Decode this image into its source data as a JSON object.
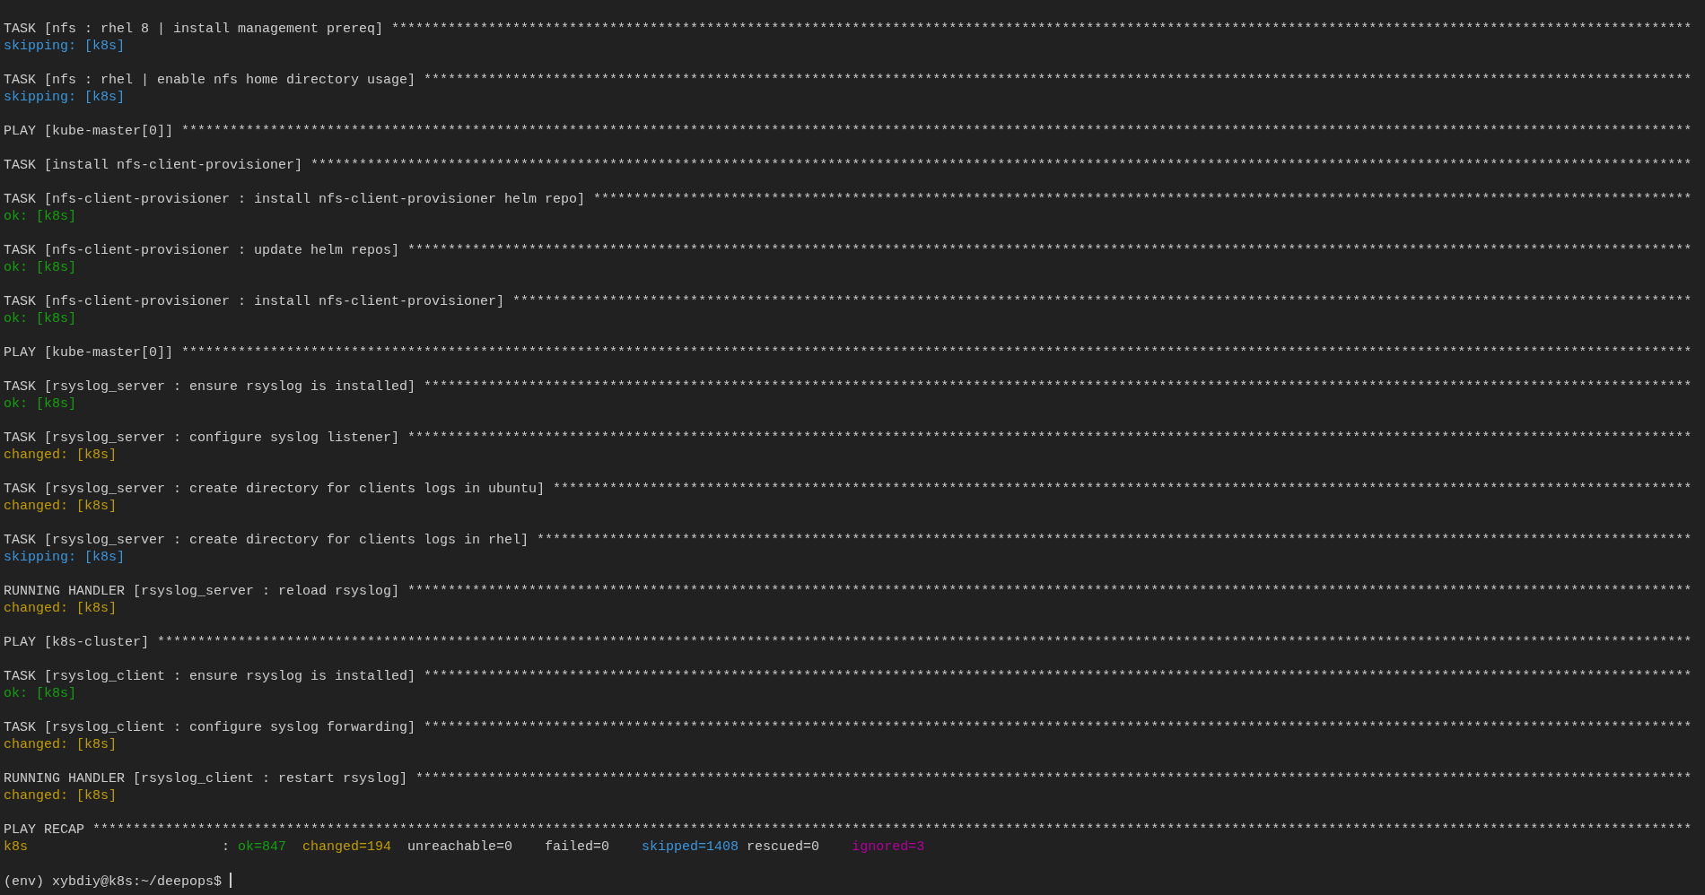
{
  "blocks": [
    {
      "header": "TASK [nfs : rhel 8 | install management prereq] *****************************************************************************************************************************************************************",
      "result": {
        "kind": "skipping",
        "text": "skipping: [k8s]"
      }
    },
    {
      "header": "TASK [nfs : rhel | enable nfs home directory usage] *************************************************************************************************************************************************************",
      "result": {
        "kind": "skipping",
        "text": "skipping: [k8s]"
      }
    },
    {
      "header": "PLAY [kube-master[0]] *******************************************************************************************************************************************************************************************"
    },
    {
      "header": "TASK [install nfs-client-provisioner] ***************************************************************************************************************************************************************************"
    },
    {
      "header": "TASK [nfs-client-provisioner : install nfs-client-provisioner helm repo] ****************************************************************************************************************************************",
      "result": {
        "kind": "ok",
        "text": "ok: [k8s]"
      }
    },
    {
      "header": "TASK [nfs-client-provisioner : update helm repos] ***************************************************************************************************************************************************************",
      "result": {
        "kind": "ok",
        "text": "ok: [k8s]"
      }
    },
    {
      "header": "TASK [nfs-client-provisioner : install nfs-client-provisioner] **************************************************************************************************************************************************",
      "result": {
        "kind": "ok",
        "text": "ok: [k8s]"
      }
    },
    {
      "header": "PLAY [kube-master[0]] *******************************************************************************************************************************************************************************************"
    },
    {
      "header": "TASK [rsyslog_server : ensure rsyslog is installed] *************************************************************************************************************************************************************",
      "result": {
        "kind": "ok",
        "text": "ok: [k8s]"
      }
    },
    {
      "header": "TASK [rsyslog_server : configure syslog listener] ***************************************************************************************************************************************************************",
      "result": {
        "kind": "changed",
        "text": "changed: [k8s]"
      }
    },
    {
      "header": "TASK [rsyslog_server : create directory for clients logs in ubuntu] *********************************************************************************************************************************************",
      "result": {
        "kind": "changed",
        "text": "changed: [k8s]"
      }
    },
    {
      "header": "TASK [rsyslog_server : create directory for clients logs in rhel] ***********************************************************************************************************************************************",
      "result": {
        "kind": "skipping",
        "text": "skipping: [k8s]"
      }
    },
    {
      "header": "RUNNING HANDLER [rsyslog_server : reload rsyslog] ***************************************************************************************************************************************************************",
      "result": {
        "kind": "changed",
        "text": "changed: [k8s]"
      }
    },
    {
      "header": "PLAY [k8s-cluster] **********************************************************************************************************************************************************************************************"
    },
    {
      "header": "TASK [rsyslog_client : ensure rsyslog is installed] *************************************************************************************************************************************************************",
      "result": {
        "kind": "ok",
        "text": "ok: [k8s]"
      }
    },
    {
      "header": "TASK [rsyslog_client : configure syslog forwarding] *************************************************************************************************************************************************************",
      "result": {
        "kind": "changed",
        "text": "changed: [k8s]"
      }
    },
    {
      "header": "RUNNING HANDLER [rsyslog_client : restart rsyslog] **************************************************************************************************************************************************************",
      "result": {
        "kind": "changed",
        "text": "changed: [k8s]"
      }
    }
  ],
  "recap": {
    "header": "PLAY RECAP ******************************************************************************************************************************************************************************************************",
    "host": {
      "text": "k8s",
      "color": "#c19c00"
    },
    "separator": ":",
    "stats": [
      {
        "text": "ok=847",
        "color": "#13a10e"
      },
      {
        "text": "changed=194",
        "color": "#c19c00"
      },
      {
        "text": "unreachable=0",
        "color": "#cccccc"
      },
      {
        "text": "failed=0",
        "color": "#cccccc"
      },
      {
        "text": "skipped=1408",
        "color": "#3a96dd"
      },
      {
        "text": "rescued=0",
        "color": "#cccccc"
      },
      {
        "text": "ignored=3",
        "color": "#b4009e"
      }
    ]
  },
  "prompt": "(env) xybdiy@k8s:~/deepops$"
}
